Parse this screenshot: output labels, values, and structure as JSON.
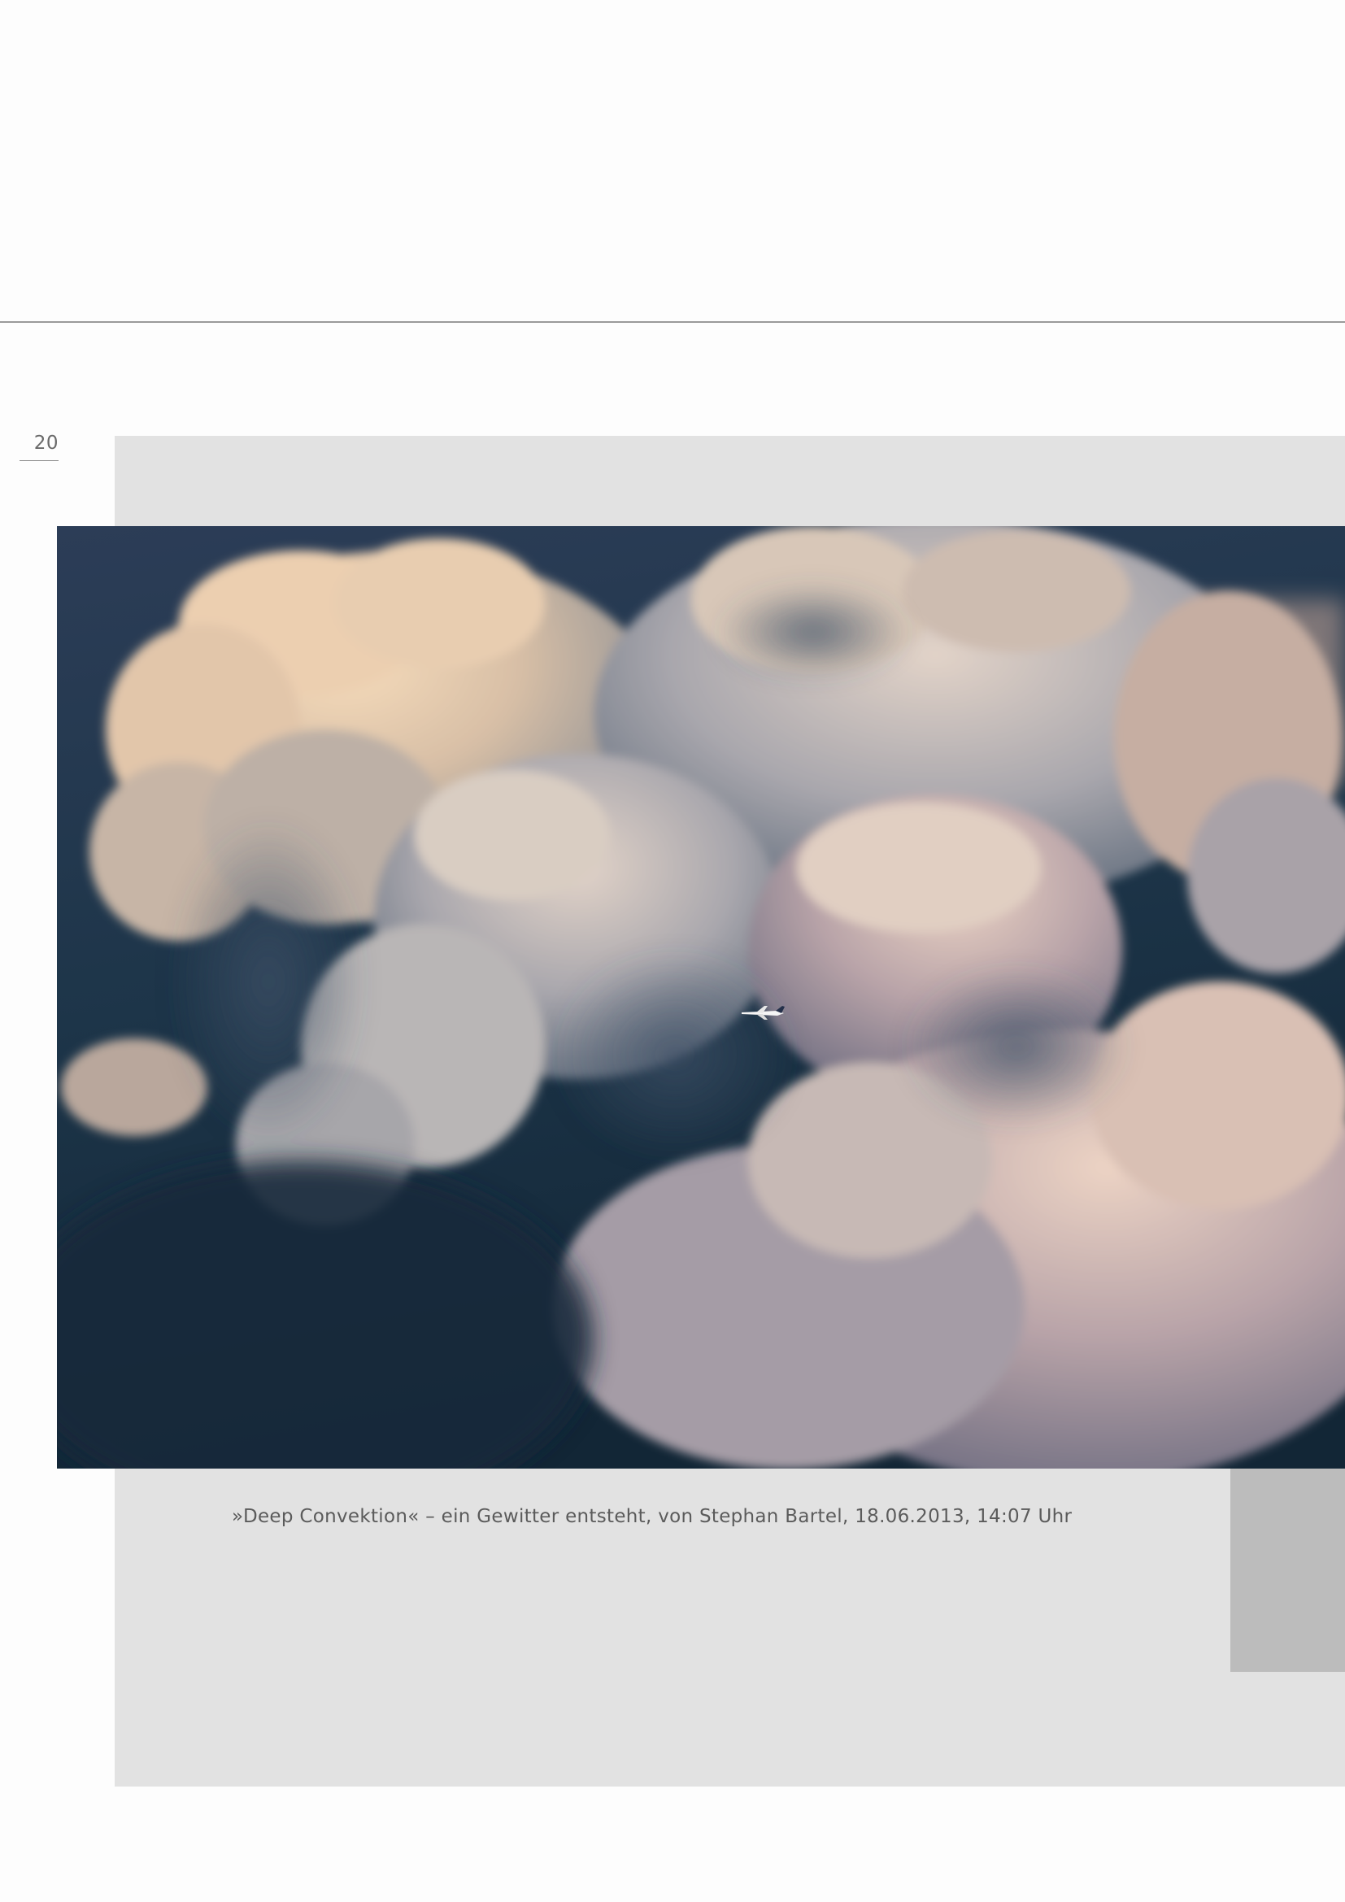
{
  "page": {
    "number": "20"
  },
  "figure": {
    "caption": "»Deep Convektion« – ein Gewitter entsteht, von Stephan Bartel, 18.06.2013, 14:07 Uhr"
  },
  "colors": {
    "background": "#fdfdfd",
    "panel": "#e2e2e2",
    "panel_tab": "#bcbcbc",
    "rule": "#9a9a9a",
    "caption_text": "#5b5b5b",
    "sky_dark": "#14283a",
    "cloud_light": "#f0d2ae"
  }
}
